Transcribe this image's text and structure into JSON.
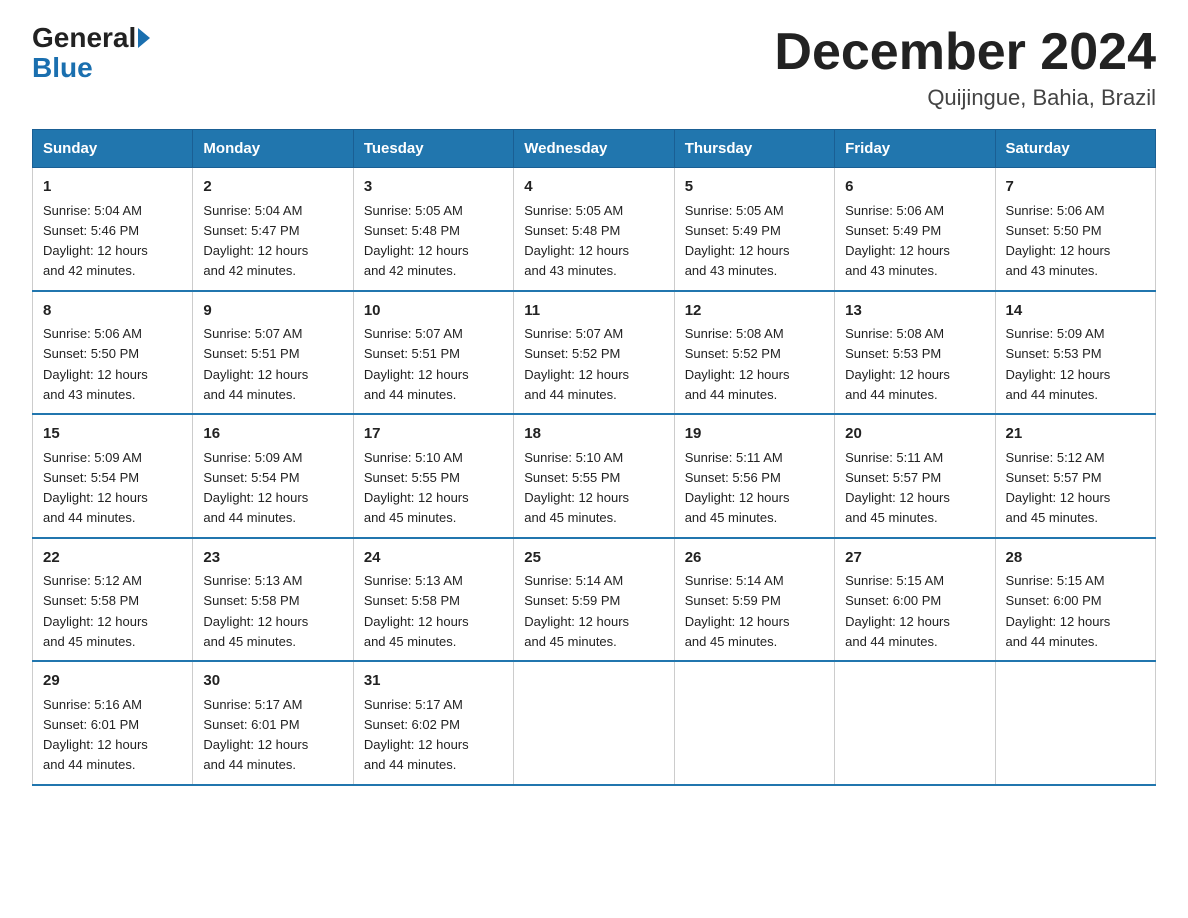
{
  "logo": {
    "general": "General",
    "blue": "Blue"
  },
  "title": "December 2024",
  "subtitle": "Quijingue, Bahia, Brazil",
  "days_of_week": [
    "Sunday",
    "Monday",
    "Tuesday",
    "Wednesday",
    "Thursday",
    "Friday",
    "Saturday"
  ],
  "weeks": [
    [
      {
        "day": "1",
        "sunrise": "5:04 AM",
        "sunset": "5:46 PM",
        "daylight": "12 hours and 42 minutes."
      },
      {
        "day": "2",
        "sunrise": "5:04 AM",
        "sunset": "5:47 PM",
        "daylight": "12 hours and 42 minutes."
      },
      {
        "day": "3",
        "sunrise": "5:05 AM",
        "sunset": "5:48 PM",
        "daylight": "12 hours and 42 minutes."
      },
      {
        "day": "4",
        "sunrise": "5:05 AM",
        "sunset": "5:48 PM",
        "daylight": "12 hours and 43 minutes."
      },
      {
        "day": "5",
        "sunrise": "5:05 AM",
        "sunset": "5:49 PM",
        "daylight": "12 hours and 43 minutes."
      },
      {
        "day": "6",
        "sunrise": "5:06 AM",
        "sunset": "5:49 PM",
        "daylight": "12 hours and 43 minutes."
      },
      {
        "day": "7",
        "sunrise": "5:06 AM",
        "sunset": "5:50 PM",
        "daylight": "12 hours and 43 minutes."
      }
    ],
    [
      {
        "day": "8",
        "sunrise": "5:06 AM",
        "sunset": "5:50 PM",
        "daylight": "12 hours and 43 minutes."
      },
      {
        "day": "9",
        "sunrise": "5:07 AM",
        "sunset": "5:51 PM",
        "daylight": "12 hours and 44 minutes."
      },
      {
        "day": "10",
        "sunrise": "5:07 AM",
        "sunset": "5:51 PM",
        "daylight": "12 hours and 44 minutes."
      },
      {
        "day": "11",
        "sunrise": "5:07 AM",
        "sunset": "5:52 PM",
        "daylight": "12 hours and 44 minutes."
      },
      {
        "day": "12",
        "sunrise": "5:08 AM",
        "sunset": "5:52 PM",
        "daylight": "12 hours and 44 minutes."
      },
      {
        "day": "13",
        "sunrise": "5:08 AM",
        "sunset": "5:53 PM",
        "daylight": "12 hours and 44 minutes."
      },
      {
        "day": "14",
        "sunrise": "5:09 AM",
        "sunset": "5:53 PM",
        "daylight": "12 hours and 44 minutes."
      }
    ],
    [
      {
        "day": "15",
        "sunrise": "5:09 AM",
        "sunset": "5:54 PM",
        "daylight": "12 hours and 44 minutes."
      },
      {
        "day": "16",
        "sunrise": "5:09 AM",
        "sunset": "5:54 PM",
        "daylight": "12 hours and 44 minutes."
      },
      {
        "day": "17",
        "sunrise": "5:10 AM",
        "sunset": "5:55 PM",
        "daylight": "12 hours and 45 minutes."
      },
      {
        "day": "18",
        "sunrise": "5:10 AM",
        "sunset": "5:55 PM",
        "daylight": "12 hours and 45 minutes."
      },
      {
        "day": "19",
        "sunrise": "5:11 AM",
        "sunset": "5:56 PM",
        "daylight": "12 hours and 45 minutes."
      },
      {
        "day": "20",
        "sunrise": "5:11 AM",
        "sunset": "5:57 PM",
        "daylight": "12 hours and 45 minutes."
      },
      {
        "day": "21",
        "sunrise": "5:12 AM",
        "sunset": "5:57 PM",
        "daylight": "12 hours and 45 minutes."
      }
    ],
    [
      {
        "day": "22",
        "sunrise": "5:12 AM",
        "sunset": "5:58 PM",
        "daylight": "12 hours and 45 minutes."
      },
      {
        "day": "23",
        "sunrise": "5:13 AM",
        "sunset": "5:58 PM",
        "daylight": "12 hours and 45 minutes."
      },
      {
        "day": "24",
        "sunrise": "5:13 AM",
        "sunset": "5:58 PM",
        "daylight": "12 hours and 45 minutes."
      },
      {
        "day": "25",
        "sunrise": "5:14 AM",
        "sunset": "5:59 PM",
        "daylight": "12 hours and 45 minutes."
      },
      {
        "day": "26",
        "sunrise": "5:14 AM",
        "sunset": "5:59 PM",
        "daylight": "12 hours and 45 minutes."
      },
      {
        "day": "27",
        "sunrise": "5:15 AM",
        "sunset": "6:00 PM",
        "daylight": "12 hours and 44 minutes."
      },
      {
        "day": "28",
        "sunrise": "5:15 AM",
        "sunset": "6:00 PM",
        "daylight": "12 hours and 44 minutes."
      }
    ],
    [
      {
        "day": "29",
        "sunrise": "5:16 AM",
        "sunset": "6:01 PM",
        "daylight": "12 hours and 44 minutes."
      },
      {
        "day": "30",
        "sunrise": "5:17 AM",
        "sunset": "6:01 PM",
        "daylight": "12 hours and 44 minutes."
      },
      {
        "day": "31",
        "sunrise": "5:17 AM",
        "sunset": "6:02 PM",
        "daylight": "12 hours and 44 minutes."
      },
      null,
      null,
      null,
      null
    ]
  ],
  "labels": {
    "sunrise": "Sunrise:",
    "sunset": "Sunset:",
    "daylight": "Daylight:"
  }
}
